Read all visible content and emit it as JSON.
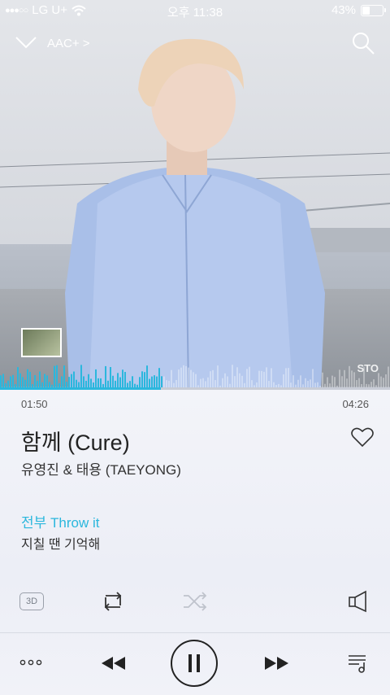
{
  "status_bar": {
    "signal": "●●●○○",
    "carrier": "LG U+",
    "time": "오후 11:38",
    "battery_percent": "43%",
    "battery_level": 0.43
  },
  "header": {
    "codec_label": "AAC+ >"
  },
  "overlay": {
    "watermark": "STO"
  },
  "playback": {
    "current_time": "01:50",
    "total_time": "04:26",
    "progress": 0.413,
    "accent_color": "#2bb7dd"
  },
  "song": {
    "title": "함께 (Cure)",
    "artist": "유영진 & 태용 (TAEYONG)"
  },
  "lyrics": {
    "current": "전부 Throw it",
    "next": "지칠 땐 기억해"
  },
  "controls": {
    "effect_label": "3D",
    "icons": [
      "chevron-down-icon",
      "search-icon",
      "heart-icon",
      "repeat-icon",
      "shuffle-icon",
      "speaker-icon",
      "more-icon",
      "previous-icon",
      "pause-icon",
      "next-icon",
      "playlist-icon"
    ]
  }
}
